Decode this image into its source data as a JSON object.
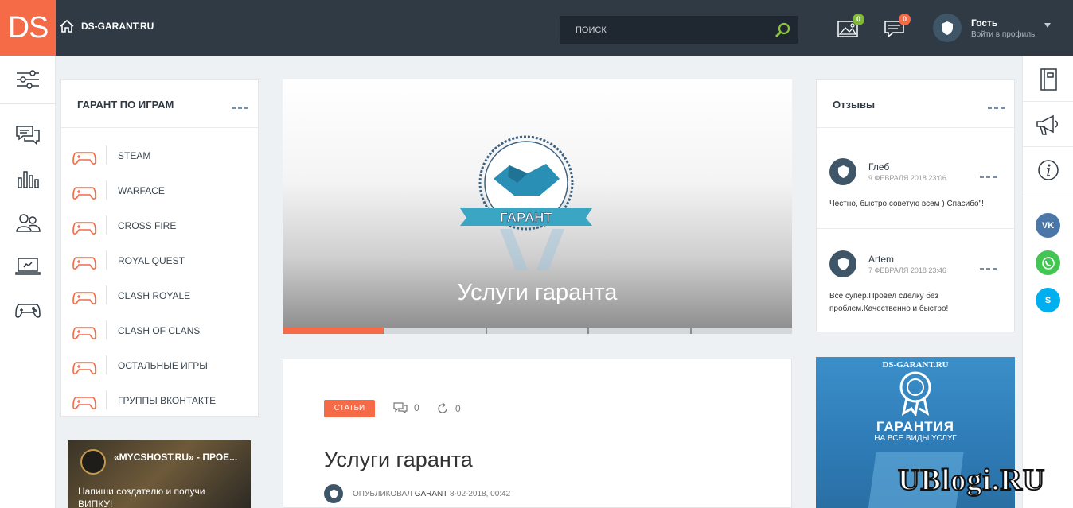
{
  "header": {
    "logo": "DS",
    "site_name": "DS-GARANT.RU",
    "search_placeholder": "ПОИСК",
    "gallery_count": "0",
    "messages_count": "0",
    "user_name": "Гость",
    "user_sub": "Войти в профиль",
    "colors": {
      "bar": "#2f3a44",
      "accent": "#f56a47",
      "green_badge": "#7fb83a"
    }
  },
  "left_sidebar": {
    "icons": [
      "sliders-icon",
      "chat-icon",
      "chart-icon",
      "users-icon",
      "laptop-icon",
      "gamepad-icon"
    ]
  },
  "games_card": {
    "title": "ГАРАНТ ПО ИГРАМ",
    "items": [
      {
        "label": "STEAM"
      },
      {
        "label": "WARFACE"
      },
      {
        "label": "CROSS FIRE"
      },
      {
        "label": "ROYAL QUEST"
      },
      {
        "label": "CLASH ROYALE"
      },
      {
        "label": "CLASH OF CLANS"
      },
      {
        "label": "ОСТАЛЬНЫЕ ИГРЫ"
      },
      {
        "label": "ГРУППЫ ВКОНТАКТЕ"
      }
    ]
  },
  "left_banner": {
    "title": "«MYCSHOST.RU» - ПРОЕ...",
    "description": "Напиши создателю и получи ВИПКУ!"
  },
  "slider": {
    "emblem_text": "ГАРАНТ",
    "caption": "Услуги гаранта",
    "slides_total": 5,
    "active_slide": 1
  },
  "post": {
    "tag": "СТАТЬИ",
    "comments": "0",
    "reposts": "0",
    "title": "Услуги гаранта",
    "published_label": "ОПУБЛИКОВАЛ",
    "author": "GARANT",
    "date": "8-02-2018, 00:42"
  },
  "reviews": {
    "title": "Отзывы",
    "items": [
      {
        "name": "Глеб",
        "date": "9 ФЕВРАЛЯ 2018 23:06",
        "text": "Честно, быстро советую всем ) Спасибо\"!"
      },
      {
        "name": "Artem",
        "date": "7 ФЕВРАЛЯ 2018 23:46",
        "text": "Всё супер.Провёл сделку без проблем.Качественно и быстро!"
      }
    ]
  },
  "ad_banner": {
    "site": "DS-GARANT.RU",
    "headline": "ГАРАНТИЯ",
    "subline": "НА ВСЕ ВИДЫ УСЛУГ"
  },
  "right_sidebar": {
    "icons": [
      "notebook-icon",
      "megaphone-icon",
      "info-icon"
    ],
    "social": [
      {
        "name": "vk-icon",
        "label": "VK",
        "color": "#4a76a8"
      },
      {
        "name": "whatsapp-icon",
        "label": "",
        "color": "#43c553"
      },
      {
        "name": "skype-icon",
        "label": "S",
        "color": "#00aff0"
      }
    ]
  },
  "watermark": "UBlogi.RU"
}
